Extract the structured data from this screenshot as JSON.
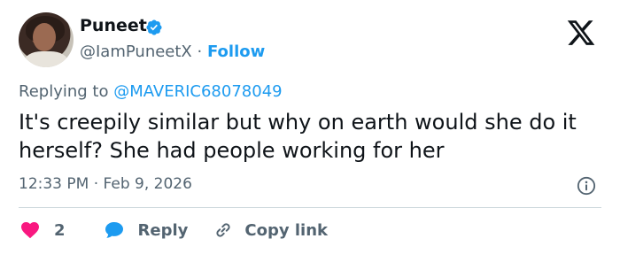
{
  "author": {
    "name": "Puneet",
    "handle": "@IamPuneetX",
    "separator": "·",
    "follow_label": "Follow"
  },
  "reply_to": {
    "prefix": "Replying to",
    "mention": "@MAVERIC68078049"
  },
  "tweet": {
    "text": "It's creepily similar but why on earth would she do it herself? She had people working for her",
    "time": "12:33 PM",
    "separator": "·",
    "date": "Feb 9, 2026"
  },
  "actions": {
    "like_count": "2",
    "reply_label": "Reply",
    "copy_link_label": "Copy link"
  },
  "colors": {
    "like": "#f91880",
    "accent": "#1d9bf0",
    "muted": "#536471"
  },
  "icons": {
    "verified": "verified-badge-icon",
    "platform": "x-logo-icon",
    "info": "info-icon",
    "like": "heart-icon",
    "reply": "speech-bubble-icon",
    "copy": "link-icon"
  }
}
